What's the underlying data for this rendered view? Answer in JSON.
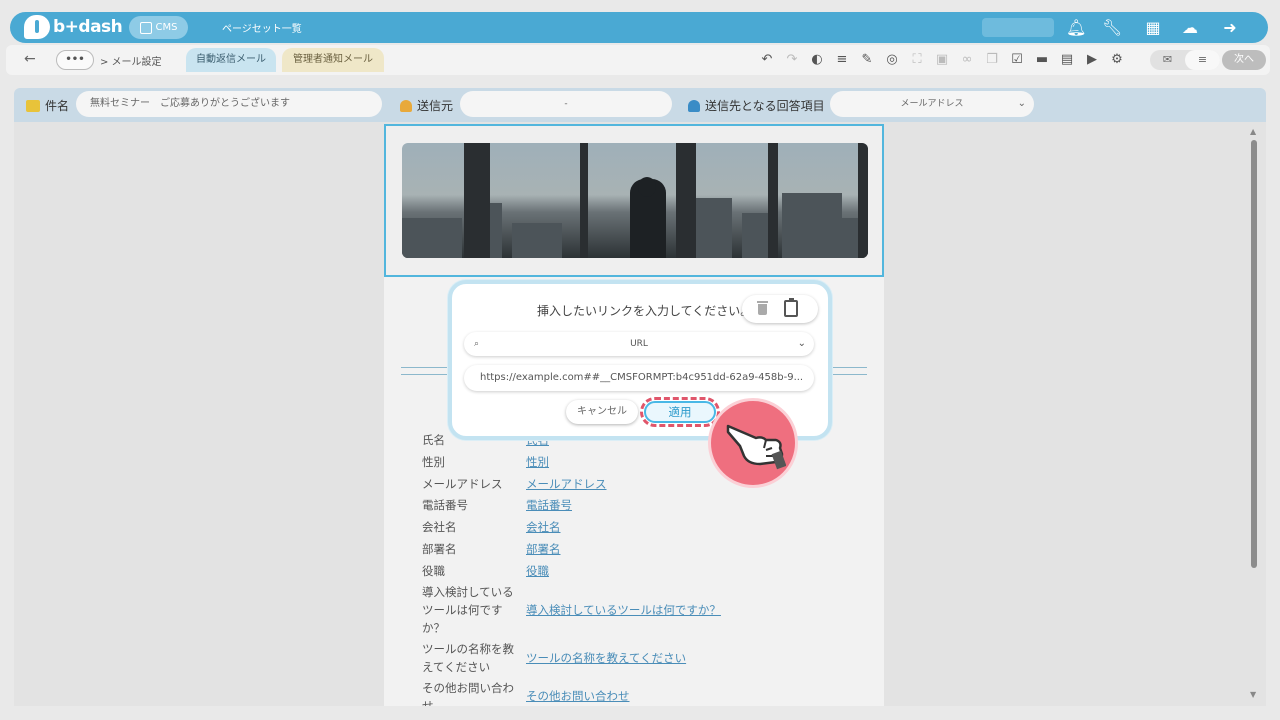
{
  "app": {
    "logo_text": "b+dash",
    "cms_label": "CMS",
    "title": "ページセット一覧"
  },
  "top_icons": [
    "bell-icon",
    "wrench-icon",
    "grid-icon",
    "chat-icon",
    "logout-icon"
  ],
  "toolbar": {
    "dots": "•••",
    "breadcrumb": "> メール設定",
    "tabs": [
      {
        "label": "自動返信メール",
        "active": true
      },
      {
        "label": "管理者通知メール",
        "active": false
      }
    ],
    "next_label": "次へ"
  },
  "meta": {
    "subject_label": "件名",
    "subject_value": "無料セミナー　ご応募ありがとうございます",
    "sender_label": "送信元",
    "sender_value": "-",
    "recipient_label": "送信先となる回答項目",
    "recipient_value": "メールアドレス"
  },
  "form_rows": [
    {
      "label": "氏名",
      "value": "氏名"
    },
    {
      "label": "性別",
      "value": "性別"
    },
    {
      "label": "メールアドレス",
      "value": "メールアドレス"
    },
    {
      "label": "電話番号",
      "value": "電話番号"
    },
    {
      "label": "会社名",
      "value": "会社名"
    },
    {
      "label": "部署名",
      "value": "部署名"
    },
    {
      "label": "役職",
      "value": "役職"
    },
    {
      "label": "導入検討している",
      "label2": "ツールは何です",
      "label3": "か？",
      "value": "導入検討しているツールは何ですか？"
    },
    {
      "label": "ツールの名称を教",
      "label2": "えてください",
      "value": "ツールの名称を教えてください"
    },
    {
      "label": "その他お問い合わ",
      "label2": "せ",
      "value": "その他お問い合わせ"
    }
  ],
  "dialog": {
    "message": "挿入したいリンクを入力してください。",
    "select_value": "URL",
    "url_value": "https://example.com##__CMSFORMPT:b4c951dd-62a9-458b-9...",
    "cancel_label": "キャンセル",
    "apply_label": "適用"
  },
  "colors": {
    "brand": "#4aa9d3",
    "accent_border": "#52b6dd",
    "highlight": "#e0566b"
  }
}
